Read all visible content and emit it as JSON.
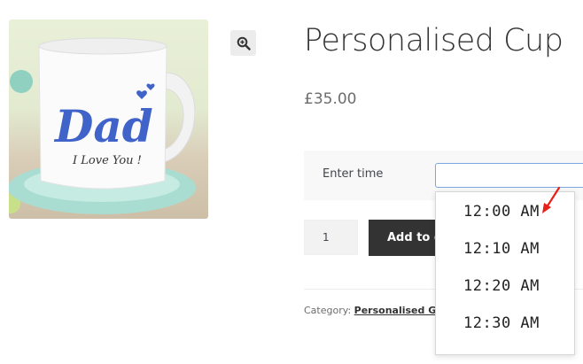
{
  "product": {
    "title": "Personalised Cup",
    "price": "£35.00",
    "image": {
      "mug_text_main": "Dad",
      "mug_text_sub": "I Love You !"
    }
  },
  "form": {
    "time_label": "Enter time",
    "time_value": "",
    "quantity": "1",
    "add_to_cart_label": "Add to cart"
  },
  "time_dropdown": {
    "options": [
      "12:00 AM",
      "12:10 AM",
      "12:20 AM",
      "12:30 AM"
    ]
  },
  "meta": {
    "category_label": "Category:",
    "category_link": "Personalised Gifting"
  },
  "icons": {
    "zoom": "zoom-in-icon",
    "annotation": "red-arrow-icon"
  },
  "colors": {
    "button_bg": "#333333",
    "input_focus_border": "#7aa7e0",
    "annotation_red": "#e8201a",
    "mug_lettering": "#3f63c9"
  }
}
